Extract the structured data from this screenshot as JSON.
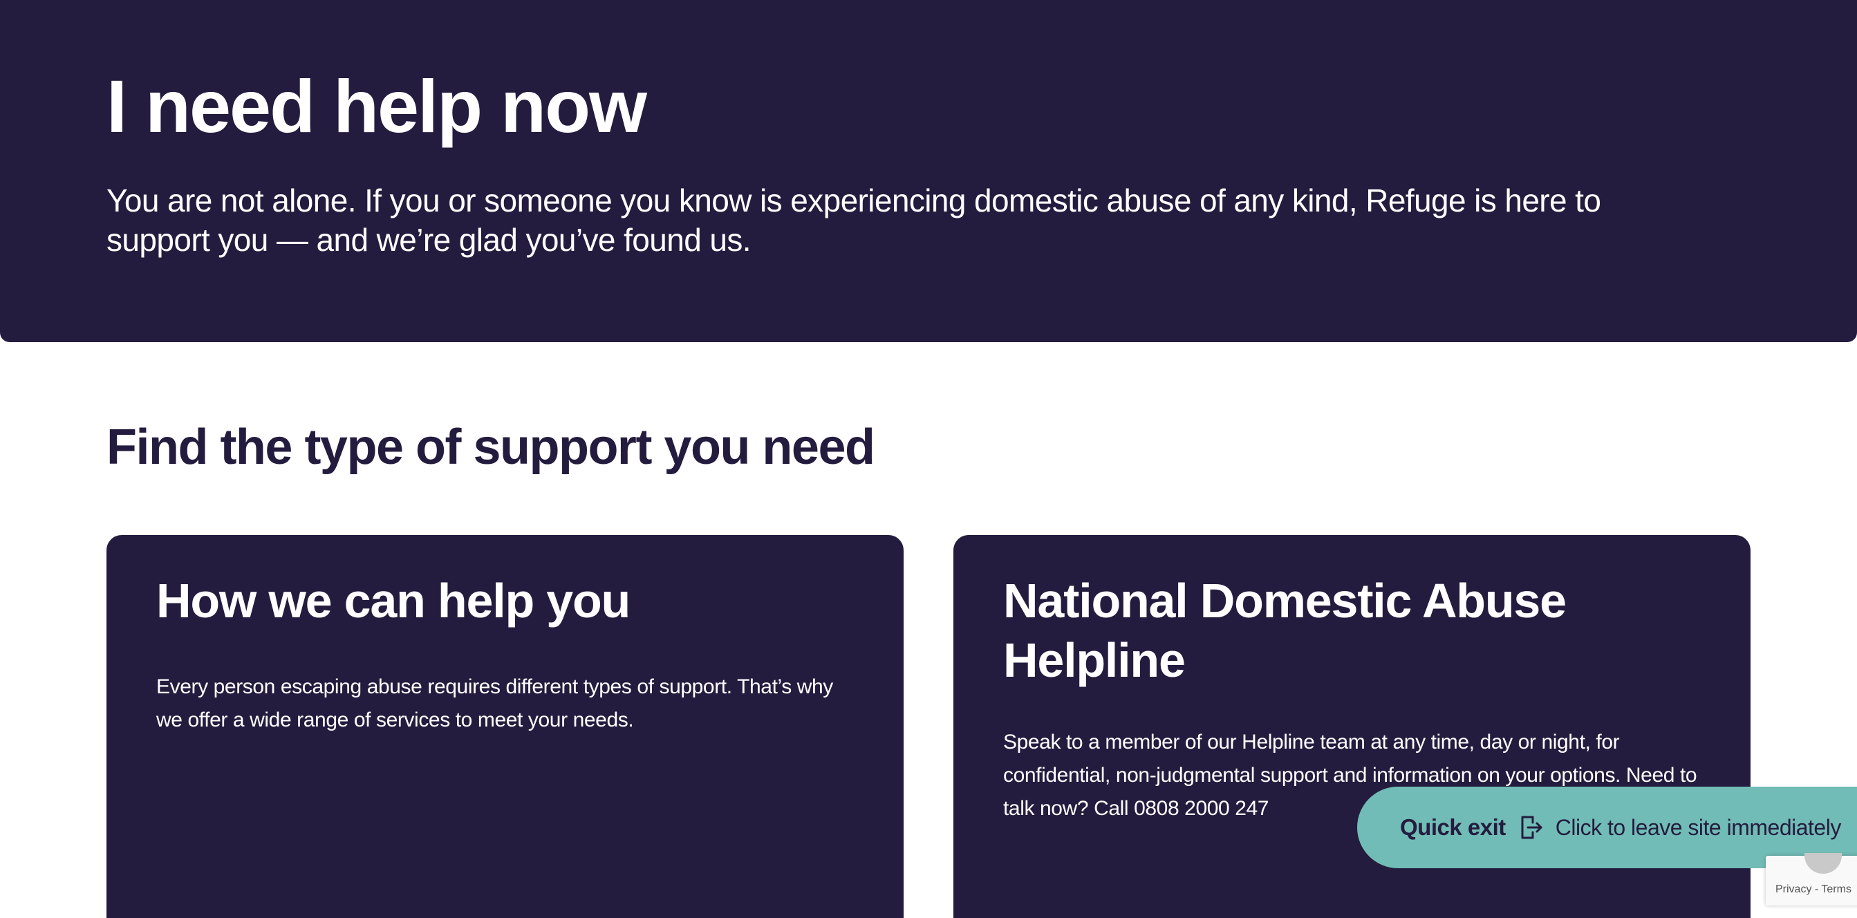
{
  "hero": {
    "title": "I need help now",
    "text": "You are not alone. If you or someone you know is experiencing domestic abuse of any kind, Refuge is here to support you — and we’re glad you’ve found us."
  },
  "support": {
    "title": "Find the type of support you need",
    "cards": [
      {
        "title": "How we can help you",
        "text": "Every person escaping abuse requires different types of support. That’s why we offer a wide range of services to meet your needs."
      },
      {
        "title": "National Domestic Abuse Helpline",
        "text": "Speak to a member of our Helpline team at any time, day or night, for confidential, non-judgmental support and information on your options. Need to talk now? Call 0808 2000 247"
      }
    ]
  },
  "quick_exit": {
    "label": "Quick exit",
    "icon": "exit-icon",
    "description": "Click to leave site immediately"
  },
  "recaptcha": {
    "privacy": "Privacy",
    "separator": " - ",
    "terms": "Terms"
  },
  "colors": {
    "brand_dark": "#241c3e",
    "quick_exit_bg": "#71bcb6",
    "background": "#ffffff"
  }
}
